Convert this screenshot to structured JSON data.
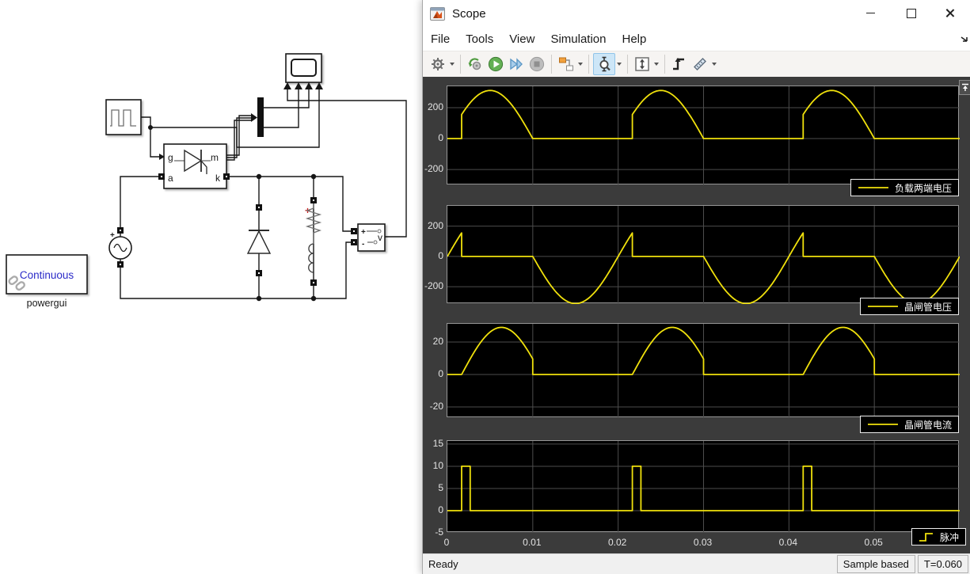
{
  "window": {
    "title": "Scope",
    "menu": [
      "File",
      "Tools",
      "View",
      "Simulation",
      "Help"
    ],
    "toolbar_icons": [
      "configuration-gear",
      "highlight-simulink-block",
      "run",
      "step-forward",
      "stop",
      "layout-style",
      "zoom-y",
      "scale-axes",
      "trigger",
      "measurements"
    ],
    "status": {
      "ready": "Ready",
      "sample": "Sample based",
      "time": "T=0.060"
    },
    "colors": {
      "trace": "#f0e10c",
      "plot_bg": "#000000",
      "region_bg": "#3b3b3b",
      "grid": "#4d4d4d",
      "zoom_selected_bg": "#cde6f7"
    }
  },
  "model": {
    "powergui": {
      "mode": "Continuous",
      "label": "powergui",
      "mode_color": "#2a2ac8"
    },
    "thyristor_ports": {
      "g": "g",
      "a": "a",
      "m": "m",
      "k": "k"
    },
    "vm": {
      "plus": "+",
      "minus": "-",
      "label": "v"
    },
    "source_plus": "+",
    "rl_plus": "+"
  },
  "chart_data": [
    {
      "type": "line",
      "title": "负载两端电压",
      "color": "#f0e10c",
      "xlim": [
        0,
        0.06
      ],
      "ylim": [
        -302,
        338
      ],
      "yticks": [
        200,
        0,
        -200
      ],
      "xticks": [
        0,
        0.01,
        0.02,
        0.03,
        0.04,
        0.05
      ],
      "grid": true,
      "legend": {
        "text": "负载两端电压",
        "glyph": "line",
        "position": "bottom-right"
      },
      "signal": {
        "repeat_period": 0.02,
        "repeat_count": 3,
        "segments": [
          {
            "t": [
              0,
              0.001667
            ],
            "const": 0
          },
          {
            "t": [
              0.001667,
              0.01
            ],
            "sine": {
              "amp": 311,
              "freq": 50
            }
          },
          {
            "t": [
              0.01,
              0.02
            ],
            "const": 0
          }
        ]
      }
    },
    {
      "type": "line",
      "title": "晶闸管电压",
      "color": "#f0e10c",
      "xlim": [
        0,
        0.06
      ],
      "ylim": [
        -314,
        334
      ],
      "yticks": [
        200,
        0,
        -200
      ],
      "xticks": [
        0,
        0.01,
        0.02,
        0.03,
        0.04,
        0.05
      ],
      "grid": true,
      "legend": {
        "text": "晶闸管电压",
        "glyph": "line",
        "position": "bottom-right"
      },
      "signal": {
        "repeat_period": 0.02,
        "repeat_count": 3,
        "segments": [
          {
            "t": [
              0,
              0.001667
            ],
            "sine": {
              "amp": 311,
              "freq": 50
            }
          },
          {
            "t": [
              0.001667,
              0.01
            ],
            "const": 0
          },
          {
            "t": [
              0.01,
              0.02
            ],
            "sine": {
              "amp": 311,
              "freq": 50
            }
          }
        ]
      }
    },
    {
      "type": "line",
      "title": "晶闸管电流",
      "color": "#f0e10c",
      "xlim": [
        0,
        0.06
      ],
      "ylim": [
        -26.8,
        31.2
      ],
      "yticks": [
        20,
        0,
        -20
      ],
      "xticks": [
        0,
        0.01,
        0.02,
        0.03,
        0.04,
        0.05
      ],
      "grid": true,
      "legend": {
        "text": "晶闸管电流",
        "glyph": "line",
        "position": "bottom-right"
      },
      "signal": {
        "repeat_period": 0.02,
        "repeat_count": 3,
        "segments": [
          {
            "t": [
              0,
              0.001667
            ],
            "const": 0
          },
          {
            "t": [
              0.001667,
              0.01
            ],
            "sine": {
              "amp": 29,
              "freq": 53.6,
              "tref": 0.001667,
              "tref_per_period": true
            }
          },
          {
            "t": [
              0.01,
              0.02
            ],
            "const": 0
          }
        ]
      }
    },
    {
      "type": "line",
      "title": "脉冲",
      "color": "#f0e10c",
      "xlim": [
        0,
        0.06
      ],
      "ylim": [
        -5,
        15.7
      ],
      "yticks": [
        15,
        10,
        5,
        0,
        -5
      ],
      "xticks": [
        0,
        0.01,
        0.02,
        0.03,
        0.04,
        0.05
      ],
      "xtick_labels": [
        "0",
        "0.01",
        "0.02",
        "0.03",
        "0.04",
        "0.05"
      ],
      "grid": true,
      "legend": {
        "text": "脉冲",
        "glyph": "step",
        "position": "bottom-right"
      },
      "signal": {
        "repeat_period": 0.02,
        "repeat_count": 3,
        "segments": [
          {
            "t": [
              0,
              0.001667
            ],
            "const": 0
          },
          {
            "t": [
              0.001667,
              0.002667
            ],
            "const": 10
          },
          {
            "t": [
              0.002667,
              0.02
            ],
            "const": 0
          }
        ]
      }
    }
  ]
}
